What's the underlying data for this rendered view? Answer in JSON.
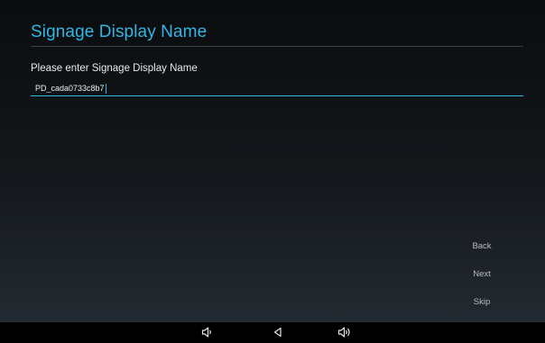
{
  "setup": {
    "title": "Signage Display Name",
    "prompt": "Please enter Signage Display Name",
    "name_value": "PD_cada0733c8b7"
  },
  "actions": {
    "back_label": "Back",
    "next_label": "Next",
    "skip_label": "Skip"
  },
  "nav_bar": {
    "icons": [
      "volume-down-icon",
      "back-icon",
      "volume-up-icon"
    ]
  },
  "colors": {
    "accent": "#33b5e5",
    "text": "#e8e8e8",
    "button_text": "#b9bdc1",
    "nav_bg": "#000000"
  }
}
